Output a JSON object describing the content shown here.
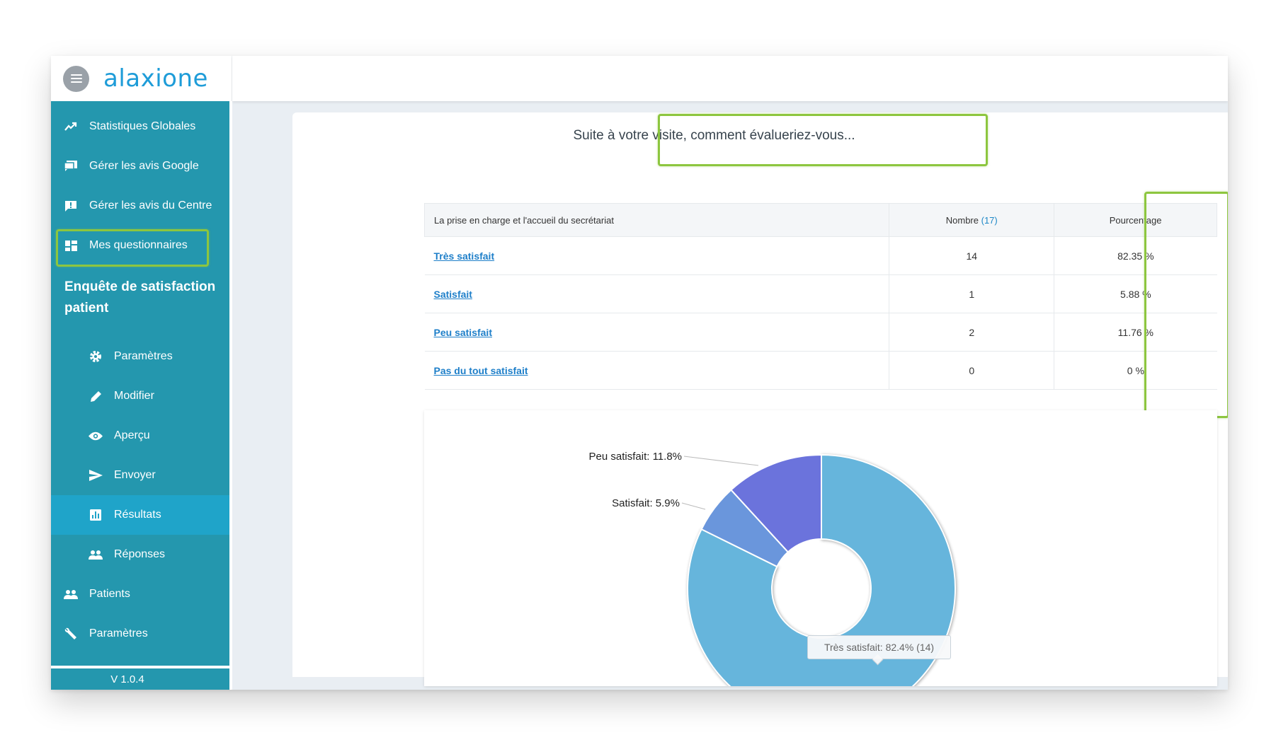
{
  "app": {
    "brand": "alaxione"
  },
  "sidebar": {
    "items": [
      {
        "label": "Statistiques Globales",
        "icon": "trending-up-icon"
      },
      {
        "label": "Gérer les avis Google",
        "icon": "chat-icon"
      },
      {
        "label": "Gérer les avis du Centre",
        "icon": "feedback-icon"
      },
      {
        "label": "Mes questionnaires",
        "icon": "dashboard-icon"
      }
    ],
    "section_title": "Enquête de satisfaction patient",
    "sub_items": [
      {
        "label": "Paramètres",
        "icon": "gear-icon"
      },
      {
        "label": "Modifier",
        "icon": "pencil-icon"
      },
      {
        "label": "Aperçu",
        "icon": "eye-icon"
      },
      {
        "label": "Envoyer",
        "icon": "send-icon"
      },
      {
        "label": "Résultats",
        "icon": "bar-chart-icon"
      },
      {
        "label": "Réponses",
        "icon": "people-icon"
      }
    ],
    "bottom_items": [
      {
        "label": "Patients",
        "icon": "people-icon"
      },
      {
        "label": "Paramètres",
        "icon": "wrench-icon"
      }
    ],
    "version": "V 1.0.4"
  },
  "question": {
    "title": "Suite à votre visite, comment évalueriez-vous..."
  },
  "table": {
    "header_question": "La prise en charge et l'accueil du secrétariat",
    "header_count": "Nombre",
    "header_total": "(17)",
    "header_percent": "Pourcentage",
    "rows": [
      {
        "label": "Très satisfait",
        "count": "14",
        "percent": "82.35 %"
      },
      {
        "label": "Satisfait",
        "count": "1",
        "percent": "5.88 %"
      },
      {
        "label": "Peu satisfait",
        "count": "2",
        "percent": "11.76 %"
      },
      {
        "label": "Pas du tout satisfait",
        "count": "0",
        "percent": "0 %"
      }
    ]
  },
  "chart_data": {
    "type": "pie",
    "title": "",
    "categories": [
      "Très satisfait",
      "Satisfait",
      "Peu satisfait",
      "Pas du tout satisfait"
    ],
    "values": [
      82.4,
      5.9,
      11.8,
      0
    ],
    "counts": [
      14,
      1,
      2,
      0
    ],
    "colors": [
      "#66b5dc",
      "#6a96dc",
      "#6b73dc",
      "#5a5fd0"
    ],
    "labels": {
      "peu": "Peu satisfait: 11.8%",
      "satisfait": "Satisfait: 5.9%"
    },
    "tooltip": "Très satisfait: 82.4% (14)",
    "donut": true
  },
  "colors": {
    "sidebar": "#2497ae",
    "active": "#1fa4c9",
    "highlight": "#8dc63f",
    "link": "#1e7fc9"
  }
}
